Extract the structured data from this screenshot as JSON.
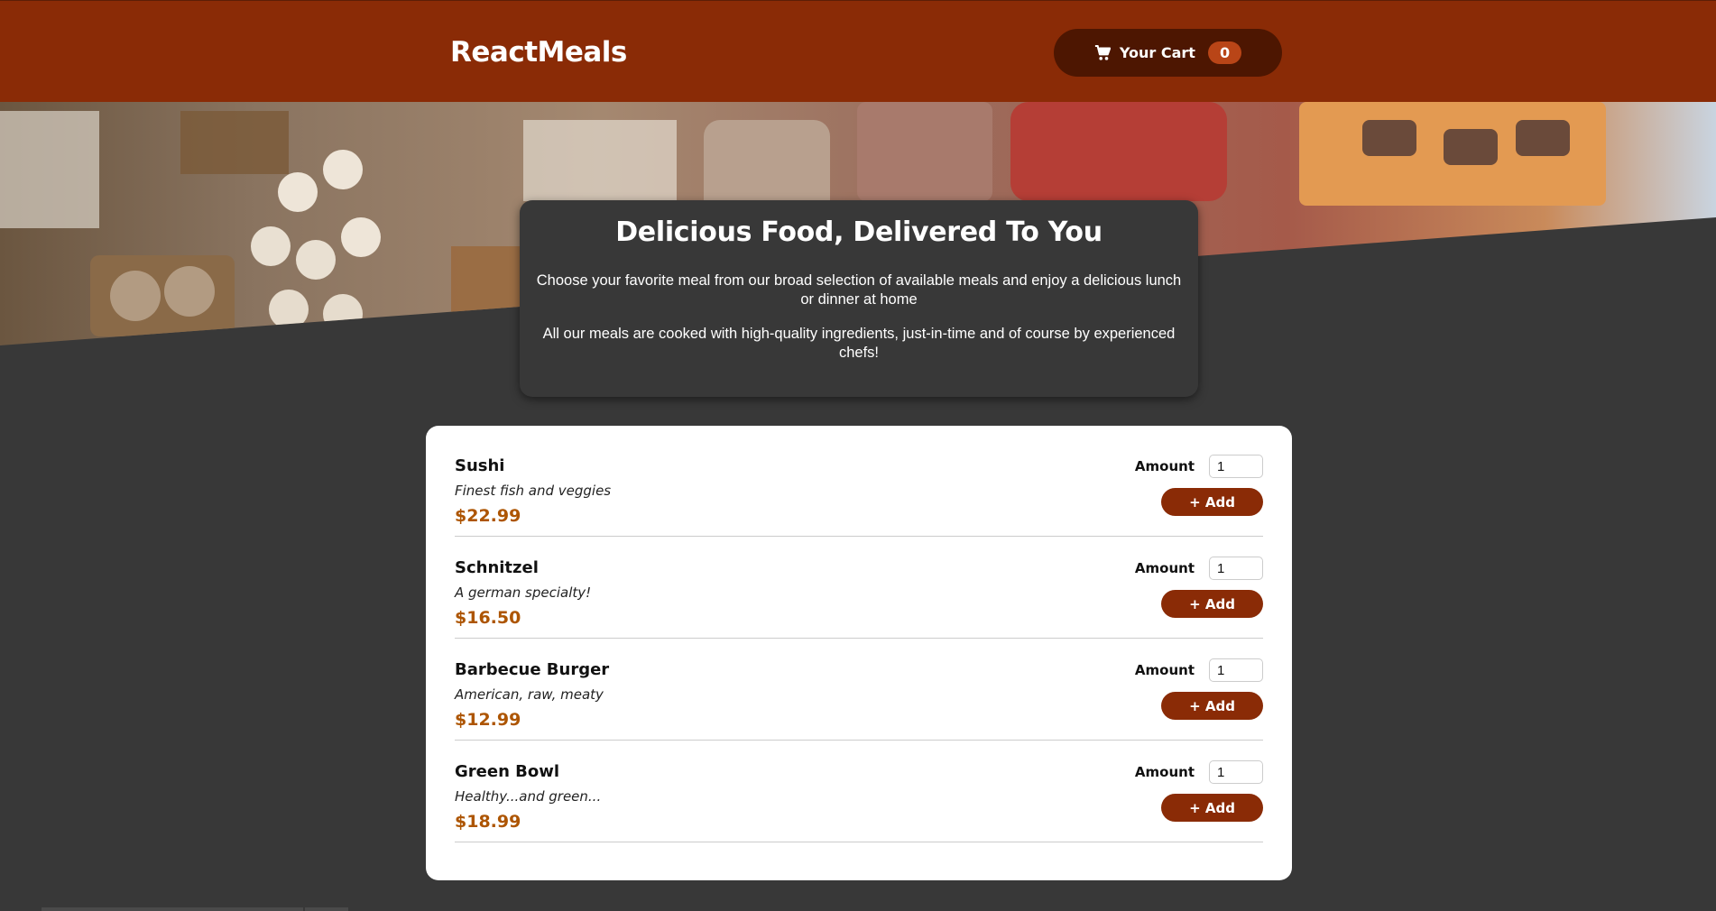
{
  "header": {
    "brand": "ReactMeals",
    "cart_label": "Your Cart",
    "cart_count": "0",
    "cart_icon": "cart-icon"
  },
  "summary": {
    "title": "Delicious Food, Delivered To You",
    "paragraph1": "Choose your favorite meal from our broad selection of available meals and enjoy a delicious lunch or dinner at home",
    "paragraph2": "All our meals are cooked with high-quality ingredients, just-in-time and of course by experienced chefs!"
  },
  "meals": [
    {
      "name": "Sushi",
      "description": "Finest fish and veggies",
      "price": "$22.99",
      "amount_label": "Amount",
      "amount": "1",
      "add_label": "+ Add"
    },
    {
      "name": "Schnitzel",
      "description": "A german specialty!",
      "price": "$16.50",
      "amount_label": "Amount",
      "amount": "1",
      "add_label": "+ Add"
    },
    {
      "name": "Barbecue Burger",
      "description": "American, raw, meaty",
      "price": "$12.99",
      "amount_label": "Amount",
      "amount": "1",
      "add_label": "+ Add"
    },
    {
      "name": "Green Bowl",
      "description": "Healthy...and green...",
      "price": "$18.99",
      "amount_label": "Amount",
      "amount": "1",
      "add_label": "+ Add"
    }
  ],
  "colors": {
    "header_bg": "#8a2b06",
    "cart_bg": "#4d1601",
    "badge_bg": "#b94517",
    "page_bg": "#383838",
    "price": "#ad5502"
  }
}
